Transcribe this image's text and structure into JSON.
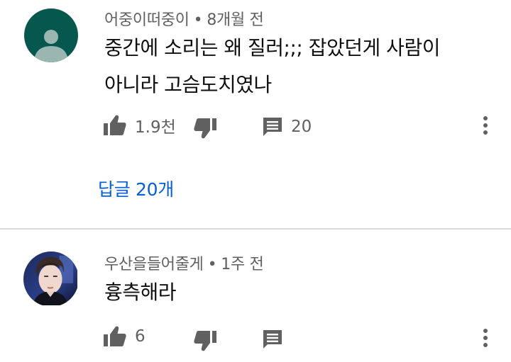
{
  "comments": [
    {
      "author": "어중이떠중이",
      "separator": "•",
      "time": "8개월 전",
      "text_lines": [
        "중간에 소리는 왜 질러;;; 잡았던게 사람이",
        "아니라 고슴도치였나"
      ],
      "like_count": "1.9천",
      "reply_count": "20",
      "replies_link": "답글 20개",
      "avatar": {
        "type": "default-person",
        "bg": "#06584f",
        "fg": "#9ab6b1"
      }
    },
    {
      "author": "우산을들어줄게",
      "separator": "•",
      "time": "1주 전",
      "text_lines": [
        "흉측해라"
      ],
      "like_count": "6",
      "avatar": {
        "type": "photo"
      }
    }
  ],
  "icons": {
    "like": "thumbs-up-icon",
    "dislike": "thumbs-down-icon",
    "reply": "comment-icon",
    "more": "more-vertical-icon"
  },
  "colors": {
    "icon": "#606060",
    "link": "#065fd4",
    "divider": "#d9d9d9"
  }
}
